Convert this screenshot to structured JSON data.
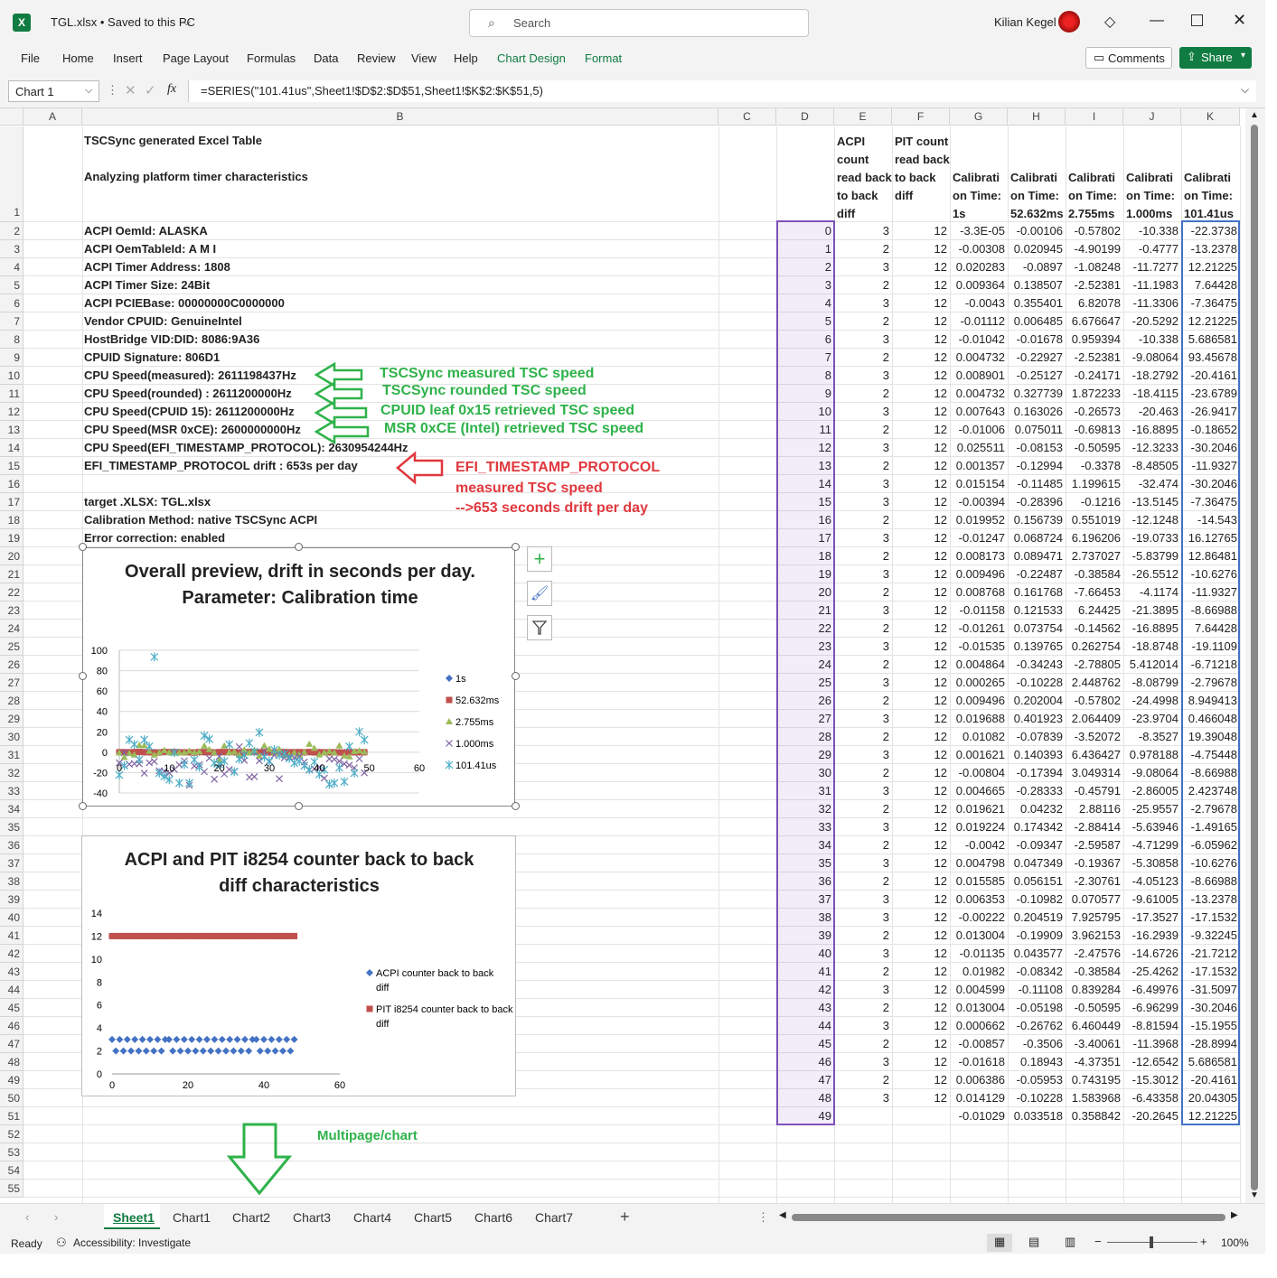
{
  "window": {
    "title": "TGL.xlsx  •  Saved to this PC",
    "user": "Kilian Kegel",
    "search_placeholder": "Search"
  },
  "ribbon": {
    "menus": [
      "File",
      "Home",
      "Insert",
      "Page Layout",
      "Formulas",
      "Data",
      "Review",
      "View",
      "Help",
      "Chart Design",
      "Format"
    ],
    "comments": "Comments",
    "share": "Share"
  },
  "formula": {
    "namebox": "Chart 1",
    "formula": "=SERIES(\"101.41us\",Sheet1!$D$2:$D$51,Sheet1!$K$2:$K$51,5)"
  },
  "columns": [
    "A",
    "B",
    "C",
    "D",
    "E",
    "F",
    "G",
    "H",
    "I",
    "J",
    "K"
  ],
  "headers": {
    "b1a": "TSCSync generated Excel Table",
    "b1b": "Analyzing platform timer characteristics",
    "e": "ACPI count read back to back diff",
    "f": "PIT count read back to back diff",
    "g": "Calibrati on Time: 1s",
    "h": "Calibrati on Time: 52.632ms",
    "i": "Calibrati on Time: 2.755ms",
    "j": "Calibrati on Time: 1.000ms",
    "k": "Calibrati on Time: 101.41us"
  },
  "colB": [
    "ACPI OemId: ALASKA",
    "ACPI OemTableId: A M I",
    "ACPI Timer Address: 1808",
    "ACPI Timer Size: 24Bit",
    "ACPI PCIEBase: 00000000C0000000",
    "Vendor CPUID: GenuineIntel",
    "HostBridge VID:DID: 8086:9A36",
    "CPUID Signature: 806D1",
    "CPU Speed(measured): 2611198437Hz",
    "CPU Speed(rounded) : 2611200000Hz",
    "CPU Speed(CPUID 15): 2611200000Hz",
    "CPU Speed(MSR 0xCE): 2600000000Hz",
    "CPU Speed(EFI_TIMESTAMP_PROTOCOL): 2630954244Hz",
    "    EFI_TIMESTAMP_PROTOCOL drift : 653s per day",
    "",
    "target .XLSX: TGL.xlsx",
    "Calibration Method: native TSCSync ACPI",
    "Error correction: enabled"
  ],
  "rows": [
    [
      "0",
      "3",
      "12",
      "-3.3E-05",
      "-0.00106",
      "-0.57802",
      "-10.338",
      "-22.3738"
    ],
    [
      "1",
      "2",
      "12",
      "-0.00308",
      "0.020945",
      "-4.90199",
      "-0.4777",
      "-13.2378"
    ],
    [
      "2",
      "3",
      "12",
      "0.020283",
      "-0.0897",
      "-1.08248",
      "-11.7277",
      "12.21225"
    ],
    [
      "3",
      "2",
      "12",
      "0.009364",
      "0.138507",
      "-2.52381",
      "-11.1983",
      "7.64428"
    ],
    [
      "4",
      "3",
      "12",
      "-0.0043",
      "0.355401",
      "6.82078",
      "-11.3306",
      "-7.36475"
    ],
    [
      "5",
      "2",
      "12",
      "-0.01112",
      "0.006485",
      "6.676647",
      "-20.5292",
      "12.21225"
    ],
    [
      "6",
      "3",
      "12",
      "-0.01042",
      "-0.01678",
      "0.959394",
      "-10.338",
      "5.686581"
    ],
    [
      "7",
      "2",
      "12",
      "0.004732",
      "-0.22927",
      "-2.52381",
      "-9.08064",
      "93.45678"
    ],
    [
      "8",
      "3",
      "12",
      "0.008901",
      "-0.25127",
      "-0.24171",
      "-18.2792",
      "-20.4161"
    ],
    [
      "9",
      "2",
      "12",
      "0.004732",
      "0.327739",
      "1.872233",
      "-18.4115",
      "-23.6789"
    ],
    [
      "10",
      "3",
      "12",
      "0.007643",
      "0.163026",
      "-0.26573",
      "-20.463",
      "-26.9417"
    ],
    [
      "11",
      "2",
      "12",
      "-0.01006",
      "0.075011",
      "-0.69813",
      "-16.8895",
      "-0.18652"
    ],
    [
      "12",
      "3",
      "12",
      "0.025511",
      "-0.08153",
      "-0.50595",
      "-12.3233",
      "-30.2046"
    ],
    [
      "13",
      "2",
      "12",
      "0.001357",
      "-0.12994",
      "-0.3378",
      "-8.48505",
      "-11.9327"
    ],
    [
      "14",
      "3",
      "12",
      "0.015154",
      "-0.11485",
      "1.199615",
      "-32.474",
      "-30.2046"
    ],
    [
      "15",
      "3",
      "12",
      "-0.00394",
      "-0.28396",
      "-0.1216",
      "-13.5145",
      "-7.36475"
    ],
    [
      "16",
      "2",
      "12",
      "0.019952",
      "0.156739",
      "0.551019",
      "-12.1248",
      "-14.543"
    ],
    [
      "17",
      "3",
      "12",
      "-0.01247",
      "0.068724",
      "6.196206",
      "-19.0733",
      "16.12765"
    ],
    [
      "18",
      "2",
      "12",
      "0.008173",
      "0.089471",
      "2.737027",
      "-5.83799",
      "12.86481"
    ],
    [
      "19",
      "3",
      "12",
      "0.009496",
      "-0.22487",
      "-0.38584",
      "-26.5512",
      "-10.6276"
    ],
    [
      "20",
      "2",
      "12",
      "0.008768",
      "0.161768",
      "-7.66453",
      "-4.1174",
      "-11.9327"
    ],
    [
      "21",
      "3",
      "12",
      "-0.01158",
      "0.121533",
      "6.24425",
      "-21.3895",
      "-8.66988"
    ],
    [
      "22",
      "2",
      "12",
      "-0.01261",
      "0.073754",
      "-0.14562",
      "-16.8895",
      "7.64428"
    ],
    [
      "23",
      "3",
      "12",
      "-0.01535",
      "0.139765",
      "0.262754",
      "-18.8748",
      "-19.1109"
    ],
    [
      "24",
      "2",
      "12",
      "0.004864",
      "-0.34243",
      "-2.78805",
      "5.412014",
      "-6.71218"
    ],
    [
      "25",
      "3",
      "12",
      "0.000265",
      "-0.10228",
      "2.448762",
      "-8.08799",
      "-2.79678"
    ],
    [
      "26",
      "2",
      "12",
      "0.009496",
      "0.202004",
      "-0.57802",
      "-24.4998",
      "8.949413"
    ],
    [
      "27",
      "3",
      "12",
      "0.019688",
      "0.401923",
      "2.064409",
      "-23.9704",
      "0.466048"
    ],
    [
      "28",
      "2",
      "12",
      "0.01082",
      "-0.07839",
      "-3.52072",
      "-8.3527",
      "19.39048"
    ],
    [
      "29",
      "3",
      "12",
      "0.001621",
      "0.140393",
      "6.436427",
      "0.978188",
      "-4.75448"
    ],
    [
      "30",
      "2",
      "12",
      "-0.00804",
      "-0.17394",
      "3.049314",
      "-9.08064",
      "-8.66988"
    ],
    [
      "31",
      "3",
      "12",
      "0.004665",
      "-0.28333",
      "-0.45791",
      "-2.86005",
      "2.423748"
    ],
    [
      "32",
      "2",
      "12",
      "0.019621",
      "0.04232",
      "2.88116",
      "-25.9557",
      "-2.79678"
    ],
    [
      "33",
      "3",
      "12",
      "0.019224",
      "0.174342",
      "-2.88414",
      "-5.63946",
      "-1.49165"
    ],
    [
      "34",
      "2",
      "12",
      "-0.0042",
      "-0.09347",
      "-2.59587",
      "-4.71299",
      "-6.05962"
    ],
    [
      "35",
      "3",
      "12",
      "0.004798",
      "0.047349",
      "-0.19367",
      "-5.30858",
      "-10.6276"
    ],
    [
      "36",
      "2",
      "12",
      "0.015585",
      "0.056151",
      "-2.30761",
      "-4.05123",
      "-8.66988"
    ],
    [
      "37",
      "3",
      "12",
      "0.006353",
      "-0.10982",
      "0.070577",
      "-9.61005",
      "-13.2378"
    ],
    [
      "38",
      "3",
      "12",
      "-0.00222",
      "0.204519",
      "7.925795",
      "-17.3527",
      "-17.1532"
    ],
    [
      "39",
      "2",
      "12",
      "0.013004",
      "-0.19909",
      "3.962153",
      "-16.2939",
      "-9.32245"
    ],
    [
      "40",
      "3",
      "12",
      "-0.01135",
      "0.043577",
      "-2.47576",
      "-14.6726",
      "-21.7212"
    ],
    [
      "41",
      "2",
      "12",
      "0.01982",
      "-0.08342",
      "-0.38584",
      "-25.4262",
      "-17.1532"
    ],
    [
      "42",
      "3",
      "12",
      "0.004599",
      "-0.11108",
      "0.839284",
      "-6.49976",
      "-31.5097"
    ],
    [
      "43",
      "2",
      "12",
      "0.013004",
      "-0.05198",
      "-0.50595",
      "-6.96299",
      "-30.2046"
    ],
    [
      "44",
      "3",
      "12",
      "0.000662",
      "-0.26762",
      "6.460449",
      "-8.81594",
      "-15.1955"
    ],
    [
      "45",
      "2",
      "12",
      "-0.00857",
      "-0.3506",
      "-3.40061",
      "-11.3968",
      "-28.8994"
    ],
    [
      "46",
      "3",
      "12",
      "-0.01618",
      "0.18943",
      "-4.37351",
      "-12.6542",
      "5.686581"
    ],
    [
      "47",
      "2",
      "12",
      "0.006386",
      "-0.05953",
      "0.743195",
      "-15.3012",
      "-20.4161"
    ],
    [
      "48",
      "3",
      "12",
      "0.014129",
      "-0.10228",
      "1.583968",
      "-6.43358",
      "20.04305"
    ],
    [
      "49",
      "",
      "",
      "-0.01029",
      "0.033518",
      "0.358842",
      "-20.2645",
      "12.21225"
    ]
  ],
  "annotations": {
    "a1": "TSCSync measured TSC speed",
    "a2": "TSCSync rounded TSC speed",
    "a3": "CPUID leaf 0x15 retrieved TSC speed",
    "a4": "MSR 0xCE (Intel) retrieved TSC speed",
    "r1": "EFI_TIMESTAMP_PROTOCOL",
    "r2": "measured TSC speed",
    "r3": "-->653 seconds drift per day",
    "mp": "Multipage/chart"
  },
  "chart_data": [
    {
      "type": "scatter",
      "title": "Overall preview, drift in seconds per day. Parameter: Calibration time",
      "xlim": [
        0,
        60
      ],
      "ylim": [
        -40,
        100
      ],
      "xticks": [
        "0",
        "10",
        "20",
        "30",
        "40",
        "50",
        "60"
      ],
      "yticks": [
        "100",
        "80",
        "60",
        "40",
        "20",
        "0",
        "-20",
        "-40"
      ],
      "series": [
        {
          "name": "1s",
          "color": "#4472c4",
          "marker": "diamond"
        },
        {
          "name": "52.632ms",
          "color": "#c0504d",
          "marker": "square"
        },
        {
          "name": "2.755ms",
          "color": "#9bbb59",
          "marker": "triangle"
        },
        {
          "name": "1.000ms",
          "color": "#8064a2",
          "marker": "x"
        },
        {
          "name": "101.41us",
          "color": "#4bacc6",
          "marker": "star"
        }
      ]
    },
    {
      "type": "scatter",
      "title": "ACPI and PIT i8254 counter back to back diff characteristics",
      "xlim": [
        0,
        60
      ],
      "ylim": [
        0,
        14
      ],
      "xticks": [
        "0",
        "20",
        "40",
        "60"
      ],
      "yticks": [
        "14",
        "12",
        "10",
        "8",
        "6",
        "4",
        "2",
        "0"
      ],
      "series": [
        {
          "name": "ACPI counter back to back diff",
          "color": "#4472c4"
        },
        {
          "name": "PIT i8254 counter back to back diff",
          "color": "#c0504d"
        }
      ]
    }
  ],
  "tabs": [
    "Sheet1",
    "Chart1",
    "Chart2",
    "Chart3",
    "Chart4",
    "Chart5",
    "Chart6",
    "Chart7"
  ],
  "status": {
    "ready": "Ready",
    "access": "Accessibility: Investigate",
    "zoom": "100%"
  }
}
